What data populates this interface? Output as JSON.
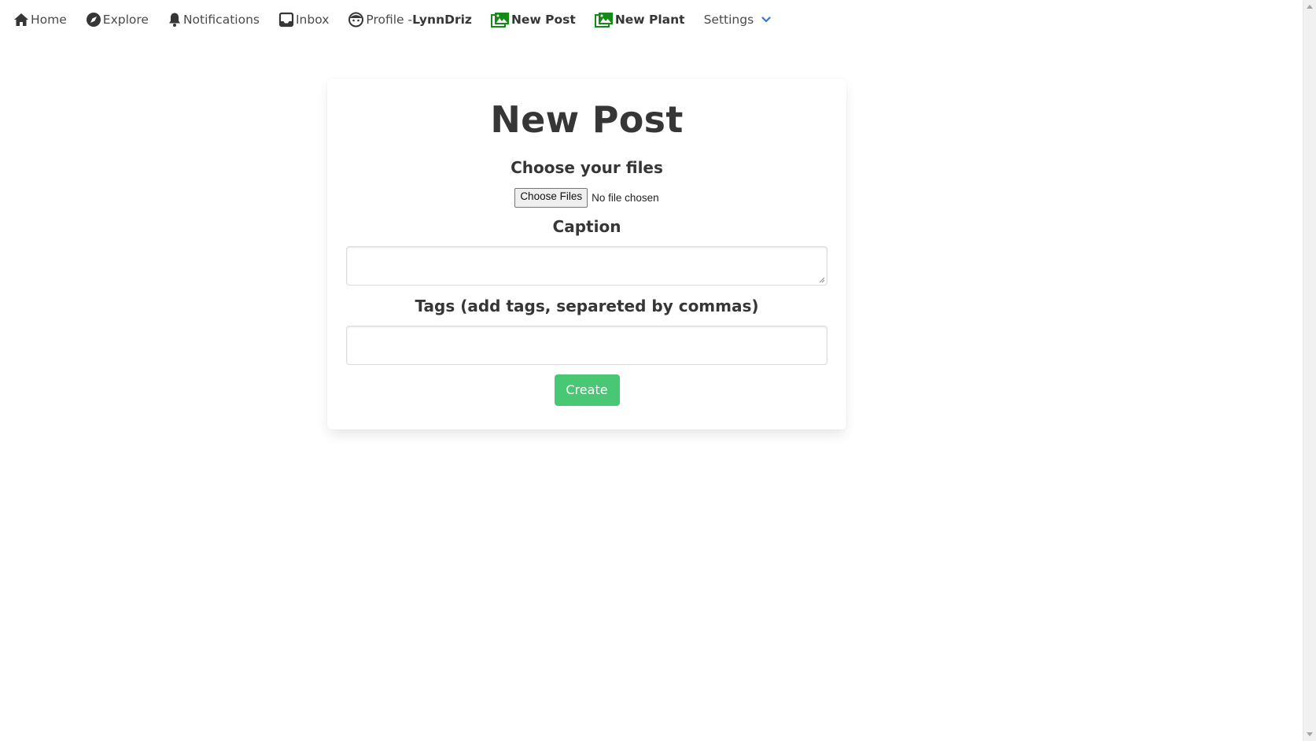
{
  "nav": {
    "home": "Home",
    "explore": "Explore",
    "notifications": "Notifications",
    "inbox": "Inbox",
    "profile_prefix": "Profile -",
    "profile_user": "LynnDriz",
    "new_post": "New Post",
    "new_plant": "New Plant",
    "settings": "Settings",
    "icons": [
      "home-icon",
      "compass-icon",
      "bell-icon",
      "inbox-icon",
      "user-face-icon",
      "image-icon",
      "image-icon",
      "chevron-down-icon"
    ]
  },
  "form": {
    "title": "New Post",
    "files_label": "Choose your files",
    "file_button": "Choose Files",
    "file_status": "No file chosen",
    "caption_label": "Caption",
    "caption_value": "",
    "tags_label": "Tags (add tags, separeted by commas)",
    "tags_value": "",
    "submit": "Create"
  },
  "colors": {
    "accent_green": "#48c774",
    "icon_green": "#168a16",
    "chevron_blue": "#3273dc",
    "text": "#363636"
  }
}
